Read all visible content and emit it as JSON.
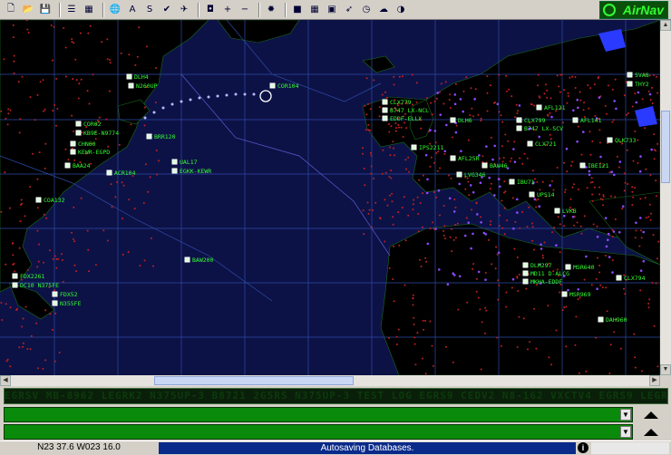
{
  "toolbar": {
    "icons": [
      "new-icon",
      "open-icon",
      "save-icon",
      "table-icon",
      "grid-icon",
      "globe-icon",
      "a-filter-icon",
      "s-filter-icon",
      "check-icon",
      "airport-icon",
      "zoom-fit-icon",
      "zoom-in-icon",
      "zoom-out-icon",
      "settings-icon",
      "layer-icon",
      "overlay-icon",
      "map-icon",
      "compass-icon",
      "clock-icon",
      "weather-icon",
      "moon-icon"
    ],
    "glyphs": [
      "🗋",
      "📂",
      "💾",
      "☰",
      "▦",
      "🌐",
      "A",
      "S",
      "✔",
      "✈",
      "◘",
      "+",
      "−",
      "✹",
      "■",
      "▦",
      "▣",
      "➶",
      "◷",
      "☁",
      "◑"
    ]
  },
  "logo": {
    "text": "AirNav"
  },
  "map": {
    "flights": [
      {
        "label": "DLH4"
      },
      {
        "label": "N260UP"
      },
      {
        "label": "COR104"
      },
      {
        "label": "COR02"
      },
      {
        "label": "KB9E-N9774"
      },
      {
        "label": "BRR120"
      },
      {
        "label": "CHN60"
      },
      {
        "label": "KEWR-EGPD"
      },
      {
        "label": "BAA24"
      },
      {
        "label": "ACR104"
      },
      {
        "label": "UAL17"
      },
      {
        "label": "EGKK-KEWR"
      },
      {
        "label": "COA132"
      },
      {
        "label": "BAW200"
      },
      {
        "label": "FDX2261"
      },
      {
        "label": "DC10 N375FE"
      },
      {
        "label": "FDX52"
      },
      {
        "label": "N355FE"
      },
      {
        "label": "CLX779"
      },
      {
        "label": "B747 LX-NCL"
      },
      {
        "label": "EDDF-ELLX"
      },
      {
        "label": "IPS2211"
      },
      {
        "label": "AFL25R"
      },
      {
        "label": "CLX799"
      },
      {
        "label": "B747 LX-SCV"
      },
      {
        "label": "AFL121"
      },
      {
        "label": "DLH6"
      },
      {
        "label": "LVG346"
      },
      {
        "label": "IBE121"
      },
      {
        "label": "BAW46"
      },
      {
        "label": "IBU71"
      },
      {
        "label": "CLX721"
      },
      {
        "label": "QLK733"
      },
      {
        "label": "UPS14"
      },
      {
        "label": "LVKB"
      },
      {
        "label": "DLH297"
      },
      {
        "label": "MD11 D-ALCG"
      },
      {
        "label": "MKHA-EDDF"
      },
      {
        "label": "MSR640"
      },
      {
        "label": "MSR969"
      },
      {
        "label": "CLX794"
      },
      {
        "label": "DAH960"
      },
      {
        "label": "AFL141"
      },
      {
        "label": "SVA8"
      },
      {
        "label": "THY2"
      }
    ]
  },
  "ticker": {
    "text": "EGRSV MB-8962 LEGRK2 N375UP-3 B8721 2G5RS N375UP-3 TEST LOG EGRS9 CEDV2 N8-162 VXCTV4 EGRS9 LEGRK2 VXCTV4 EGRS9 UPS14 TEST"
  },
  "status": {
    "coords": "N23 37.6 W023 16.0",
    "message": "Autosaving Databases."
  },
  "colors": {
    "map_bg": "#0d1246",
    "label": "#33ff33",
    "land": "#000000",
    "msgbar": "#0a8a0a"
  }
}
